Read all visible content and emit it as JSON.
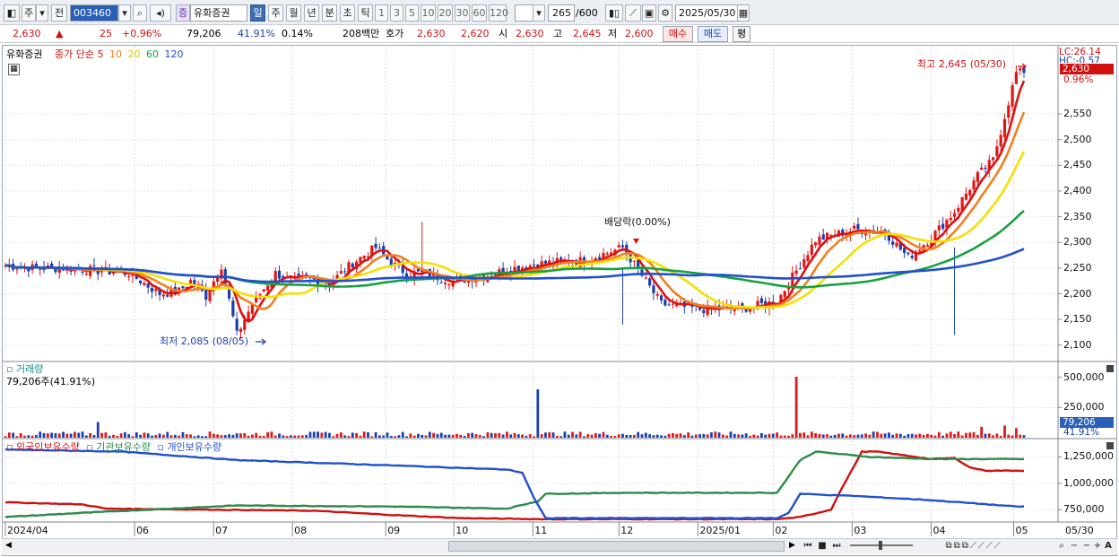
{
  "toolbar": {
    "period_label": "주",
    "prev_label": "전",
    "code_value": "003460",
    "stock_badge": "증",
    "stock_name": "유화증권",
    "tabs": [
      "일",
      "주",
      "월",
      "년",
      "분",
      "초",
      "틱"
    ],
    "active_tab": "일",
    "intervals": [
      "1",
      "3",
      "5",
      "10",
      "20",
      "30",
      "60",
      "120"
    ],
    "count_value": "265",
    "count_total": "/600",
    "date_value": "2025/05/30"
  },
  "quote": {
    "price": "2,630",
    "arrow": "▲",
    "change": "25",
    "change_pct": "+0.96%",
    "volume": "79,206",
    "vol_ratio": "41.91%",
    "turnover": "0.14%",
    "trade_value": "208백만",
    "ask_label": "호가",
    "ask1": "2,630",
    "ask2": "2,620",
    "open_label": "시",
    "open": "2,630",
    "high_label": "고",
    "high": "2,645",
    "low_label": "저",
    "low": "2,600",
    "buy_label": "매수",
    "sell_label": "매도",
    "eval_label": "평"
  },
  "price_pane": {
    "legend_name": "유화증권",
    "legend_ma": "종가 단순",
    "ma_periods": [
      "5",
      "10",
      "20",
      "60",
      "120"
    ],
    "ma_colors": [
      "#e01010",
      "#f08020",
      "#f5e000",
      "#18a040",
      "#2050d0"
    ],
    "lc_label": "LC:26.14",
    "hc_label": "HC:-0.57",
    "price_tag": "2,630",
    "pct_tag": "0.96%",
    "high_annotation": "최고 2,645 (05/30)",
    "low_annotation": "최저 2,085 (08/05)",
    "dividend_annotation": "배당락(0.00%)"
  },
  "volume_pane": {
    "title": "거래량",
    "subtitle": "79,206주(41.91%)",
    "tag_value": "79,206",
    "tag_pct": "41.91%"
  },
  "holding_pane": {
    "legend": [
      "외국인보유수량",
      "기관보유수량",
      "개인보유수량"
    ]
  },
  "x_axis": {
    "labels": [
      "2024/04",
      "06",
      "07",
      "08",
      "09",
      "10",
      "11",
      "12",
      "2025/01",
      "02",
      "03",
      "04",
      "05"
    ],
    "end_label": "05/30"
  },
  "chart_data": [
    {
      "type": "candlestick",
      "title": "유화증권",
      "y_ticks": [
        "2,100",
        "2,150",
        "2,200",
        "2,250",
        "2,300",
        "2,350",
        "2,400",
        "2,450",
        "2,500",
        "2,550"
      ],
      "ylim": [
        2070,
        2660
      ],
      "x_labels": [
        "2024/04",
        "06",
        "07",
        "08",
        "09",
        "10",
        "11",
        "12",
        "2025/01",
        "02",
        "03",
        "04",
        "05"
      ],
      "series": [
        {
          "name": "5",
          "color": "#e01010"
        },
        {
          "name": "10",
          "color": "#f08020"
        },
        {
          "name": "20",
          "color": "#f5e000"
        },
        {
          "name": "60",
          "color": "#18a040"
        },
        {
          "name": "120",
          "color": "#2050d0"
        }
      ],
      "close_x": [
        0,
        8,
        16,
        24,
        32,
        40,
        45,
        48,
        52,
        56,
        60,
        64,
        70,
        74,
        78,
        84,
        90,
        96,
        100,
        104,
        108,
        116,
        124,
        132,
        140,
        150,
        160,
        170,
        180,
        190,
        200,
        210,
        220,
        228,
        234,
        240,
        246,
        252,
        256,
        262
      ],
      "close_y": [
        2255,
        2250,
        2250,
        2245,
        2240,
        2200,
        2205,
        2225,
        2195,
        2255,
        2120,
        2180,
        2240,
        2225,
        2230,
        2220,
        2260,
        2290,
        2260,
        2240,
        2240,
        2225,
        2235,
        2250,
        2260,
        2265,
        2290,
        2180,
        2170,
        2170,
        2185,
        2305,
        2325,
        2320,
        2270,
        2310,
        2360,
        2430,
        2460,
        2630
      ],
      "annotations": [
        "최고 2,645 (05/30)",
        "최저 2,085 (08/05)",
        "배당락(0.00%)"
      ]
    },
    {
      "type": "bar",
      "title": "거래량",
      "y_ticks": [
        "500,000",
        "250,000"
      ],
      "ylim": [
        0,
        520000
      ],
      "spikes_x": [
        24,
        138,
        205,
        253,
        259,
        262
      ],
      "spikes_values": [
        130000,
        400000,
        505000,
        90000,
        100000,
        79206
      ],
      "base_level": 30000
    },
    {
      "type": "line",
      "y_ticks": [
        "1,250,000",
        "1,000,000",
        "750,000"
      ],
      "ylim": [
        650000,
        1330000
      ],
      "series": [
        {
          "name": "외국인보유수량",
          "color": "#d01010",
          "x": [
            0,
            20,
            26,
            80,
            100,
            118,
            138,
            200,
            206,
            214,
            216,
            222,
            226,
            240,
            246,
            250,
            254,
            262
          ],
          "y": [
            820000,
            800000,
            760000,
            740000,
            700000,
            670000,
            660000,
            660000,
            680000,
            750000,
            900000,
            1300000,
            1300000,
            1230000,
            1240000,
            1150000,
            1120000,
            1120000
          ]
        },
        {
          "name": "기관보유수량",
          "color": "#2d8a4a",
          "x": [
            0,
            20,
            60,
            100,
            130,
            138,
            140,
            160,
            200,
            206,
            210,
            224,
            240,
            262
          ],
          "y": [
            680000,
            720000,
            790000,
            780000,
            760000,
            830000,
            900000,
            910000,
            910000,
            1220000,
            1300000,
            1250000,
            1230000,
            1230000
          ]
        },
        {
          "name": "개인보유수량",
          "color": "#2050d0",
          "x": [
            0,
            30,
            60,
            100,
            130,
            134,
            137,
            140,
            200,
            203,
            206,
            220,
            240,
            262
          ],
          "y": [
            1320000,
            1300000,
            1220000,
            1170000,
            1130000,
            1100000,
            860000,
            670000,
            670000,
            720000,
            900000,
            880000,
            840000,
            780000
          ]
        }
      ]
    }
  ]
}
